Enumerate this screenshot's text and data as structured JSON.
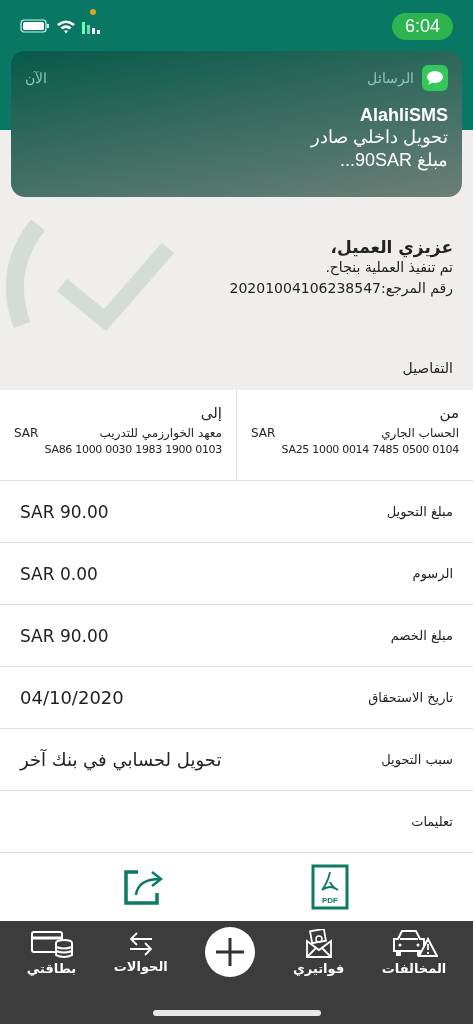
{
  "status_bar": {
    "time": "6:04"
  },
  "notification": {
    "app": "الرسائل",
    "time": "الآن",
    "sender": "AlahliSMS",
    "lines": [
      "تحويل داخلي صادر",
      "مبلغ 90SAR..."
    ]
  },
  "confirmation": {
    "greeting": "عزيزي العميل،",
    "message": "تم تنفيذ العملية بنجاح.",
    "reference": "رقم المرجع:20201004106238547"
  },
  "details_title": "التفاصيل",
  "parties": [
    {
      "label": "من",
      "name": "الحساب الجاري",
      "currency": "SAR",
      "iban": "SA25 1000 0014 7485 0500 0104"
    },
    {
      "label": "إلى",
      "name": "معهد الخوارزمي للتدريب",
      "currency": "SAR",
      "iban": "SA86 1000 0030 1983 1900 0103"
    }
  ],
  "rows": [
    {
      "label": "مبلغ التحويل",
      "value": "SAR 90.00",
      "kind": "amount"
    },
    {
      "label": "الرسوم",
      "value": "SAR 0.00",
      "kind": "amount"
    },
    {
      "label": "مبلغ الخصم",
      "value": "SAR 90.00",
      "kind": "amount"
    },
    {
      "label": "تاريخ الاستحقاق",
      "value": "04/10/2020",
      "kind": "text"
    },
    {
      "label": "سبب التحويل",
      "value": "تحويل لحسابي في بنك آخر",
      "kind": "text"
    },
    {
      "label": "تعليمات"
    }
  ],
  "actions": [
    {
      "kind": "pdf",
      "text": "PDF"
    },
    {
      "kind": "share"
    }
  ],
  "tabs": [
    {
      "label": "المخالفات",
      "kind": "car"
    },
    {
      "label": "فواتيري",
      "kind": "bills"
    },
    {
      "kind": "plus"
    },
    {
      "label": "الحوالات",
      "kind": "transfer"
    },
    {
      "label": "بطاقتي",
      "kind": "cards"
    }
  ]
}
